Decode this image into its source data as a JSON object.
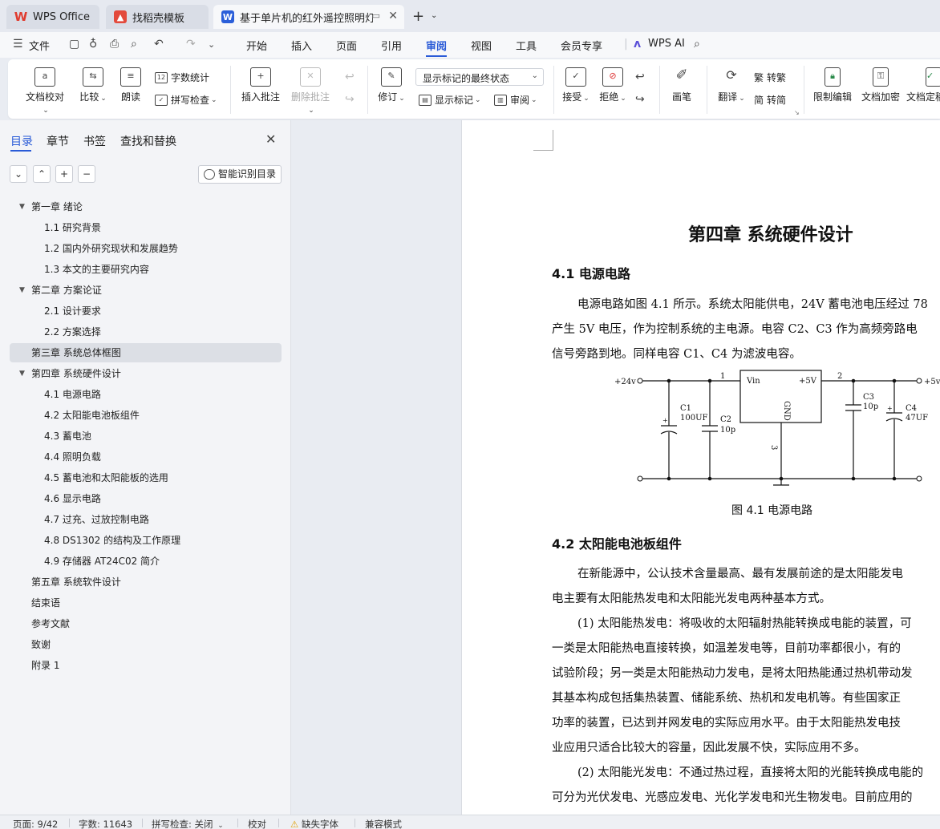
{
  "tabs": [
    {
      "label": "WPS Office",
      "icon": "wps-logo-icon"
    },
    {
      "label": "找稻壳模板",
      "icon": "docer-icon"
    },
    {
      "label": "基于单片机的红外遥控照明灯系",
      "icon": "word-doc-icon"
    }
  ],
  "tab_icon_letters": {
    "doc": "W"
  },
  "menu": {
    "file": "文件",
    "items": [
      "开始",
      "插入",
      "页面",
      "引用",
      "审阅",
      "视图",
      "工具",
      "会员专享"
    ],
    "active": "审阅",
    "wps_ai": "WPS AI"
  },
  "ribbon": {
    "doc_proof": "文档校对",
    "compare": "比较",
    "read_aloud": "朗读",
    "word_count": "字数统计",
    "spell_check": "拼写检查",
    "insert_comment": "插入批注",
    "delete_comment": "删除批注",
    "track": "修订",
    "markup_select": "显示标记的最终状态",
    "show_markup": "显示标记",
    "review": "审阅",
    "accept": "接受",
    "reject": "拒绝",
    "pen": "画笔",
    "translate": "翻译",
    "to_traditional": "转繁",
    "to_simplified": "转简",
    "restrict_edit": "限制编辑",
    "doc_encrypt": "文档加密",
    "doc_final": "文档定稿",
    "glyph_trad": "繁",
    "glyph_simp": "简"
  },
  "nav": {
    "tabs": [
      "目录",
      "章节",
      "书签",
      "查找和替换"
    ],
    "smart_toc": "智能识别目录",
    "toc": [
      {
        "label": "第一章  绪论",
        "level": 1,
        "expanded": true
      },
      {
        "label": "1.1 研究背景",
        "level": 2
      },
      {
        "label": "1.2 国内外研究现状和发展趋势",
        "level": 2
      },
      {
        "label": "1.3 本文的主要研究内容",
        "level": 2
      },
      {
        "label": "第二章  方案论证",
        "level": 1,
        "expanded": true
      },
      {
        "label": "2.1  设计要求",
        "level": 2
      },
      {
        "label": "2.2  方案选择",
        "level": 2
      },
      {
        "label": "第三章  系统总体框图",
        "level": 1,
        "selected": true
      },
      {
        "label": "第四章  系统硬件设计",
        "level": 1,
        "expanded": true
      },
      {
        "label": "4.1  电源电路",
        "level": 2
      },
      {
        "label": "4.2  太阳能电池板组件",
        "level": 2
      },
      {
        "label": "4.3  蓄电池",
        "level": 2
      },
      {
        "label": "4.4  照明负载",
        "level": 2
      },
      {
        "label": "4.5  蓄电池和太阳能板的选用",
        "level": 2
      },
      {
        "label": "4.6  显示电路",
        "level": 2
      },
      {
        "label": "4.7  过充、过放控制电路",
        "level": 2
      },
      {
        "label": "4.8 DS1302 的结构及工作原理",
        "level": 2
      },
      {
        "label": "4.9  存储器 AT24C02 简介",
        "level": 2
      },
      {
        "label": "第五章  系统软件设计",
        "level": 1
      },
      {
        "label": "结束语",
        "level": 1
      },
      {
        "label": "参考文献",
        "level": 1
      },
      {
        "label": "致谢",
        "level": 1
      },
      {
        "label": "附录 1",
        "level": 1
      }
    ]
  },
  "doc": {
    "chapter_title": "第四章  系统硬件设计",
    "sec1": "4.1  电源电路",
    "p1": [
      "电源电路如图 4.1 所示。系统太阳能供电，24V 蓄电池电压经过 78",
      "产生 5V 电压，作为控制系统的主电源。电容 C2、C3 作为高频旁路电",
      "信号旁路到地。同样电容 C1、C4 为滤波电容。"
    ],
    "figure_caption": "图 4.1    电源电路",
    "sec2": "4.2  太阳能电池板组件",
    "p2": [
      "在新能源中，公认技术含量最高、最有发展前途的是太阳能发电",
      "电主要有太阳能热发电和太阳能光发电两种基本方式。",
      "(1) 太阳能热发电：将吸收的太阳辐射热能转换成电能的装置，可",
      "一类是太阳能热电直接转换，如温差发电等，目前功率都很小，有的",
      "试验阶段；另一类是太阳能热动力发电，是将太阳热能通过热机带动发",
      "其基本构成包括集热装置、储能系统、热机和发电机等。有些国家正",
      "功率的装置，已达到并网发电的实际应用水平。由于太阳能热发电技",
      "业应用只适合比较大的容量，因此发展不快，实际应用不多。",
      "(2) 太阳能光发电：不通过热过程，直接将太阳的光能转换成电能的",
      "可分为光伏发电、光感应发电、光化学发电和光生物发电。目前应用的"
    ],
    "circuit_labels": {
      "vin_label": "+24v",
      "vout_label": "+5v",
      "chip_in": "Vin",
      "chip_out": "+5V",
      "chip_gnd": "GND",
      "pin1": "1",
      "pin2": "2",
      "pin3": "3",
      "c1": "C1",
      "c1v": "100UF",
      "c2": "C2",
      "c2v": "10p",
      "c3": "C3",
      "c3v": "10p",
      "c4": "C4",
      "c4v": "47UF",
      "plus": "+"
    }
  },
  "status": {
    "page": "页面: 9/42",
    "words": "字数: 11643",
    "spell": "拼写检查: 关闭",
    "proof": "校对",
    "missing_font": "缺失字体",
    "compat": "兼容模式"
  }
}
